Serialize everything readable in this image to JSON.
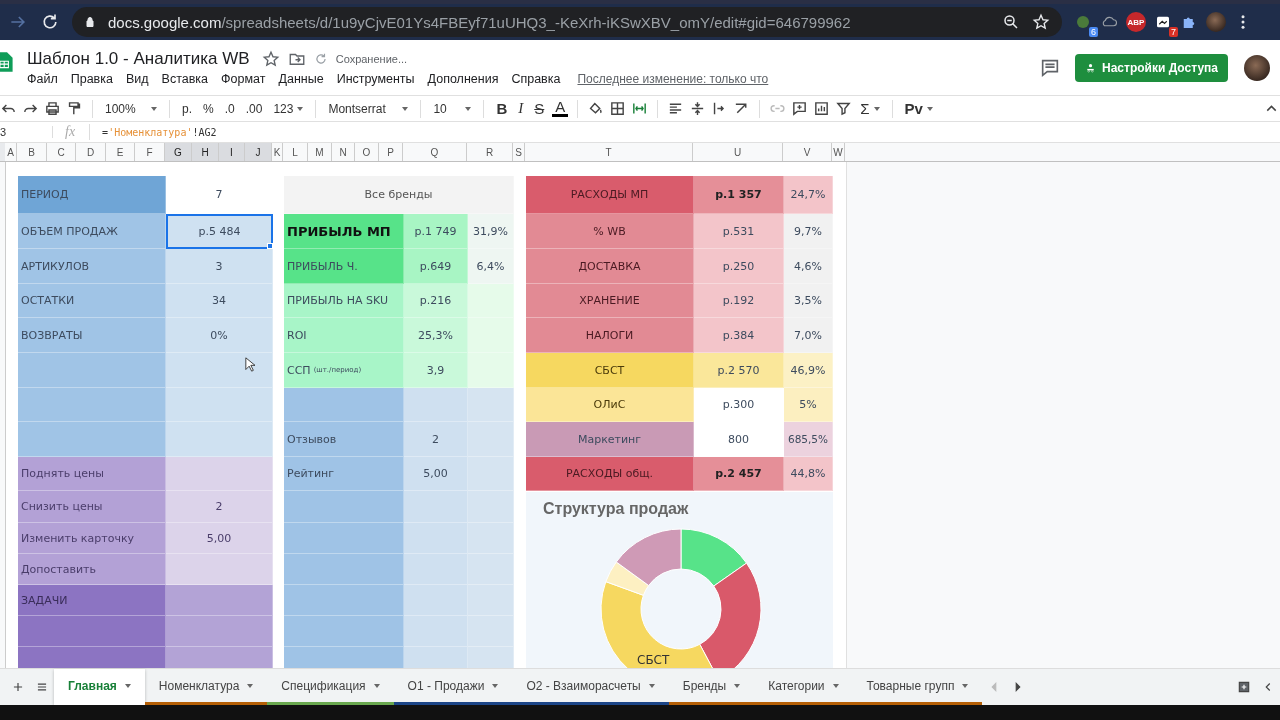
{
  "browser": {
    "url_domain": "docs.google.com",
    "url_path": "/spreadsheets/d/1u9yCjvE01Ys4FBEyf71uUHQ3_-KeXrh-iKSwXBV_omY/edit#gid=646799962",
    "badge_first": "6",
    "abp": "ABP",
    "badge_second": "7"
  },
  "doc": {
    "title": "Шаблон 1.0 - Аналитика WB",
    "save_status": "Сохранение...",
    "menu": [
      "Файл",
      "Правка",
      "Вид",
      "Вставка",
      "Формат",
      "Данные",
      "Инструменты",
      "Дополнения",
      "Справка"
    ],
    "last_edit": "Последнее изменение: только что",
    "share_button": "Настройки Доступа"
  },
  "toolbar": {
    "zoom": "100%",
    "currency": "р.",
    "percent": "%",
    "dec_less": ".0",
    "dec_more": ".00",
    "format": "123",
    "font": "Montserrat",
    "size": "10",
    "bold": "B",
    "italic": "I",
    "strike": "S",
    "text_color": "A",
    "functions": "Σ",
    "input_tools": "Рv"
  },
  "formula_bar": {
    "name_box": "3",
    "fx": "fx",
    "formula_start": "=",
    "formula_string": "'Номенклатура'",
    "formula_end": "!AG2"
  },
  "columns": [
    {
      "label": "A",
      "selected": false
    },
    {
      "label": "B",
      "selected": false
    },
    {
      "label": "C",
      "selected": false
    },
    {
      "label": "D",
      "selected": false
    },
    {
      "label": "E",
      "selected": false
    },
    {
      "label": "F",
      "selected": false
    },
    {
      "label": "G",
      "selected": true
    },
    {
      "label": "H",
      "selected": true
    },
    {
      "label": "I",
      "selected": true
    },
    {
      "label": "J",
      "selected": true
    },
    {
      "label": "K",
      "selected": false
    },
    {
      "label": "L",
      "selected": false
    },
    {
      "label": "M",
      "selected": false
    },
    {
      "label": "N",
      "selected": false
    },
    {
      "label": "O",
      "selected": false
    },
    {
      "label": "P",
      "selected": false
    },
    {
      "label": "Q",
      "selected": false
    },
    {
      "label": "R",
      "selected": false
    },
    {
      "label": "S",
      "selected": false
    },
    {
      "label": "T",
      "selected": false
    },
    {
      "label": "U",
      "selected": false
    },
    {
      "label": "V",
      "selected": false
    },
    {
      "label": "W",
      "selected": false
    }
  ],
  "left_block": {
    "rows": [
      {
        "kind": "period",
        "label": "ПЕРИОД",
        "value": "7",
        "selected": false
      },
      {
        "kind": "metric",
        "label": "ОБЪЕМ ПРОДАЖ",
        "value": "р.5 484",
        "selected": true
      },
      {
        "kind": "metric",
        "label": "АРТИКУЛОВ",
        "value": "3",
        "selected": false
      },
      {
        "kind": "metric",
        "label": "ОСТАТКИ",
        "value": "34",
        "selected": false
      },
      {
        "kind": "metric",
        "label": "ВОЗВРАТЫ",
        "value": "0%",
        "selected": false
      },
      {
        "kind": "metric",
        "selected": false
      },
      {
        "kind": "metric",
        "selected": false
      },
      {
        "kind": "metric",
        "selected": false
      },
      {
        "kind": "task",
        "label": "Поднять цены",
        "selected": false
      },
      {
        "kind": "task",
        "label": "Снизить цены",
        "value": "2",
        "selected": false
      },
      {
        "kind": "task",
        "label": "Изменить карточку",
        "value": "5,00",
        "selected": false
      },
      {
        "kind": "task",
        "label": "Допоставить",
        "selected": false
      },
      {
        "kind": "tasks_header",
        "label": "ЗАДАЧИ",
        "selected": false
      },
      {
        "kind": "tasks_header",
        "selected": false
      },
      {
        "kind": "tasks_header",
        "selected": false
      }
    ]
  },
  "brand_block": {
    "title": "Все бренды",
    "rows": [
      {
        "kind": "profit_main",
        "label": "ПРИБЫЛЬ МП",
        "value": "р.1 749",
        "percent": "31,9%"
      },
      {
        "kind": "profit",
        "label": "ПРИБЫЛЬ Ч.",
        "value": "р.649",
        "percent": "6,4%"
      },
      {
        "kind": "green",
        "label": "ПРИБЫЛЬ НА SKU",
        "value": "р.216"
      },
      {
        "kind": "green",
        "label": "ROI",
        "value": "25,3%"
      },
      {
        "kind": "green",
        "label": "ССП",
        "note": "(шт./период)",
        "value": "3,9"
      },
      {
        "kind": "info"
      },
      {
        "kind": "info",
        "label": "Отзывов",
        "value": "2"
      },
      {
        "kind": "info",
        "label": "Рейтинг",
        "value": "5,00"
      },
      {
        "kind": "info"
      },
      {
        "kind": "info"
      },
      {
        "kind": "info"
      },
      {
        "kind": "info"
      },
      {
        "kind": "info"
      },
      {
        "kind": "info"
      }
    ]
  },
  "expense_block": {
    "rows": [
      {
        "kind": "total",
        "label": "РАСХОДЫ МП",
        "value": "р.1 357",
        "percent": "24,7%"
      },
      {
        "kind": "expense",
        "label": "% WB",
        "value": "р.531",
        "percent": "9,7%"
      },
      {
        "kind": "expense",
        "label": "ДОСТАВКА",
        "value": "р.250",
        "percent": "4,6%"
      },
      {
        "kind": "expense",
        "label": "ХРАНЕНИЕ",
        "value": "р.192",
        "percent": "3,5%"
      },
      {
        "kind": "expense",
        "label": "НАЛОГИ",
        "value": "р.384",
        "percent": "7,0%"
      },
      {
        "kind": "cost",
        "label": "СБСТ",
        "value": "р.2 570",
        "percent": "46,9%"
      },
      {
        "kind": "ops",
        "label": "ОЛиС",
        "value": "р.300",
        "percent": "5%"
      },
      {
        "kind": "marketing",
        "label": "Маркетинг",
        "value": "800",
        "percent": "685,5%"
      },
      {
        "kind": "total",
        "label": "РАСХОДЫ общ.",
        "value": "р.2 457",
        "percent": "44,8%"
      }
    ]
  },
  "chart": {
    "title": "Структура продаж",
    "label": "СБСТ"
  },
  "sheet_tabs": [
    {
      "label": "Главная",
      "selected": true
    },
    {
      "label": "Номенклатура",
      "selected": false,
      "color": "#b45f06"
    },
    {
      "label": "Спецификация",
      "selected": false,
      "color": "#6aa84f"
    },
    {
      "label": "О1 - Продажи",
      "selected": false,
      "color": "#1c4587"
    },
    {
      "label": "О2 - Взаиморасчеты",
      "selected": false,
      "color": "#1c4587"
    },
    {
      "label": "Бренды",
      "selected": false,
      "color": "#b45f06"
    },
    {
      "label": "Категории",
      "selected": false,
      "color": "#b45f06"
    },
    {
      "label": "Товарные групп",
      "selected": false,
      "color": "#b45f06"
    }
  ]
}
